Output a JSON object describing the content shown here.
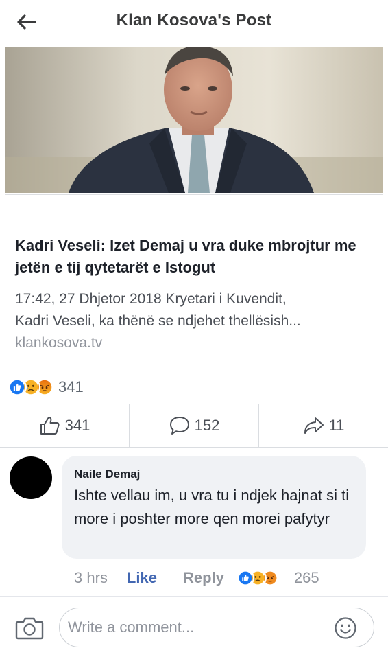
{
  "header": {
    "title": "Klan Kosova's Post",
    "back_icon": "arrow-left-icon"
  },
  "link_card": {
    "image_description_icon": "news-photo",
    "headline": "Kadri Veseli: Izet Demaj u vra duke mbrojtur me jetën e tij qytetarët e Istogut",
    "description_line1": "17:42, 27 Dhjetor 2018 Kryetari i Kuvendit,",
    "description_line2": "Kadri Veseli, ka thënë se ndjehet thellësish...",
    "domain": "klankosova.tv"
  },
  "reactions": {
    "icons": [
      "like-icon",
      "sad-icon",
      "angry-icon"
    ],
    "count": "341",
    "colors": {
      "like": "#1877f2",
      "sad": "#f7b125",
      "angry": "#e9710f"
    }
  },
  "actions": {
    "like": {
      "icon": "thumbs-up-icon",
      "count": "341"
    },
    "comment": {
      "icon": "comment-bubble-icon",
      "count": "152"
    },
    "share": {
      "icon": "share-arrow-icon",
      "count": "11"
    }
  },
  "comment": {
    "author": "Naile Demaj",
    "text": "Ishte vellau im, u vra tu i ndjek hajnat si ti more i poshter more qen morei pafytyr",
    "time": "3 hrs",
    "like_label": "Like",
    "reply_label": "Reply",
    "reaction_count": "265"
  },
  "composer": {
    "placeholder": "Write a comment...",
    "camera_icon": "camera-icon",
    "emoji_icon": "smiley-icon"
  },
  "colors": {
    "accent": "#4267b2",
    "muted_text": "#90949c",
    "bubble_bg": "#f0f2f5"
  }
}
